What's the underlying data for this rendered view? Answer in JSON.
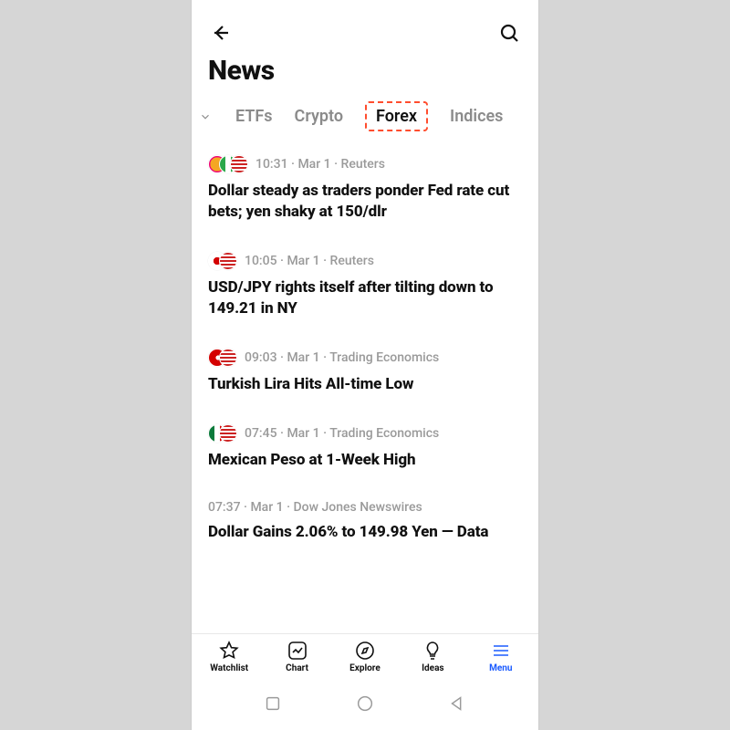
{
  "header": {
    "title": "News"
  },
  "tabs": {
    "items": [
      {
        "label": "ETFs",
        "active": false
      },
      {
        "label": "Crypto",
        "active": false
      },
      {
        "label": "Forex",
        "active": true
      },
      {
        "label": "Indices",
        "active": false
      }
    ]
  },
  "news": [
    {
      "flags": [
        "fl-generic-orange",
        "fl-generic-green",
        "fl-us"
      ],
      "time": "10:31",
      "date": "Mar 1",
      "source": "Reuters",
      "headline": "Dollar steady as traders ponder Fed rate cut bets; yen shaky at 150/dlr"
    },
    {
      "flags": [
        "fl-japan",
        "fl-us"
      ],
      "time": "10:05",
      "date": "Mar 1",
      "source": "Reuters",
      "headline": "USD/JPY rights itself after tilting down to 149.21 in NY"
    },
    {
      "flags": [
        "fl-turkey",
        "fl-us"
      ],
      "time": "09:03",
      "date": "Mar 1",
      "source": "Trading Economics",
      "headline": "Turkish Lira Hits All-time Low"
    },
    {
      "flags": [
        "fl-mexico",
        "fl-us"
      ],
      "time": "07:45",
      "date": "Mar 1",
      "source": "Trading Economics",
      "headline": "Mexican Peso at 1-Week High"
    },
    {
      "flags": [],
      "time": "07:37",
      "date": "Mar 1",
      "source": "Dow Jones Newswires",
      "headline": "Dollar Gains 2.06% to 149.98 Yen — Data"
    }
  ],
  "tabbar": {
    "items": [
      {
        "label": "Watchlist",
        "active": false
      },
      {
        "label": "Chart",
        "active": false
      },
      {
        "label": "Explore",
        "active": false
      },
      {
        "label": "Ideas",
        "active": false
      },
      {
        "label": "Menu",
        "active": true
      }
    ]
  },
  "meta_sep": " · "
}
